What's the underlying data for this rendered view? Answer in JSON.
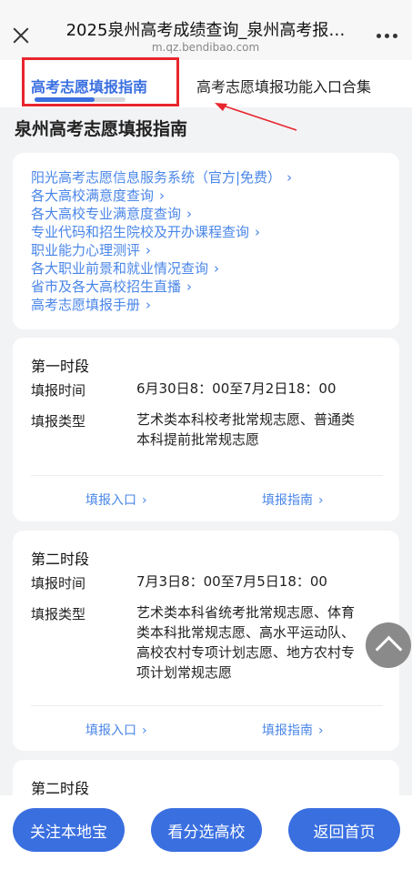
{
  "header": {
    "title": "2025泉州高考成绩查询_泉州高考报…",
    "url": "m.qz.bendibao.com",
    "close_icon": "close-icon",
    "more_icon": "more-dots-icon"
  },
  "tabs": [
    {
      "label": "高考志愿填报指南",
      "active": true
    },
    {
      "label": "高考志愿填报功能入口合集",
      "active": false
    }
  ],
  "section_title": "泉州高考志愿填报指南",
  "links": [
    {
      "label": "阳光高考志愿信息服务系统（官方|免费）"
    },
    {
      "label": "各大高校满意度查询"
    },
    {
      "label": "各大高校专业满意度查询"
    },
    {
      "label": "专业代码和招生院校及开办课程查询"
    },
    {
      "label": "职业能力心理测评"
    },
    {
      "label": "各大职业前景和就业情况查询"
    },
    {
      "label": "省市及各大高校招生直播"
    },
    {
      "label": "高考志愿填报手册"
    }
  ],
  "periods": [
    {
      "title": "第一时段",
      "time_label": "填报时间",
      "time_value": "6月30日8：00至7月2日18：00",
      "type_label": "填报类型",
      "type_value": "艺术类本科校考批常规志愿、普通类本科提前批常规志愿",
      "entry_label": "填报入口",
      "guide_label": "填报指南"
    },
    {
      "title": "第二时段",
      "time_label": "填报时间",
      "time_value": "7月3日8：00至7月5日18：00",
      "type_label": "填报类型",
      "type_value": "艺术类本科省统考批常规志愿、体育类本科批常规志愿、高水平运动队、高校农村专项计划志愿、地方农村专项计划常规志愿",
      "entry_label": "填报入口",
      "guide_label": "填报指南"
    },
    {
      "title": "第二时段"
    }
  ],
  "bottom_buttons": [
    {
      "label": "关注本地宝"
    },
    {
      "label": "看分选高校"
    },
    {
      "label": "返回首页"
    }
  ],
  "colors": {
    "accent": "#3a6fe0",
    "link": "#4a86e8",
    "annotation_red": "#e8262d"
  }
}
